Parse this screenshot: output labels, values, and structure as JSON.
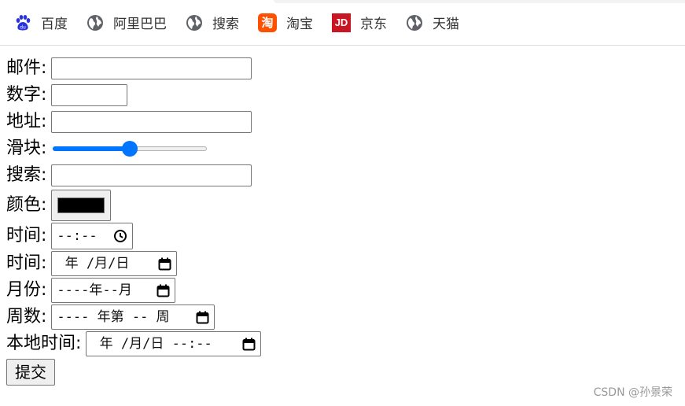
{
  "bookmarks": [
    {
      "label": "百度",
      "icon": "baidu-paw-icon"
    },
    {
      "label": "阿里巴巴",
      "icon": "globe-icon"
    },
    {
      "label": "搜索",
      "icon": "globe-icon"
    },
    {
      "label": "淘宝",
      "icon": "taobao-icon",
      "icon_text": "淘"
    },
    {
      "label": "京东",
      "icon": "jd-icon",
      "icon_text": "JD"
    },
    {
      "label": "天猫",
      "icon": "globe-icon"
    }
  ],
  "form": {
    "email_label": "邮件:",
    "number_label": "数字:",
    "url_label": "地址:",
    "range_label": "滑块:",
    "range_value": 0.5,
    "search_label": "搜索:",
    "color_label": "颜色:",
    "color_value": "#000000",
    "time_label": "时间:",
    "time_placeholder": "--:--",
    "date_label": "时间:",
    "date_placeholder": " 年 /月/日",
    "month_label": "月份:",
    "month_placeholder": "----年--月",
    "week_label": "周数:",
    "week_placeholder": "---- 年第 -- 周",
    "datetime_label": "本地时间:",
    "datetime_placeholder": " 年 /月/日 --:--",
    "submit_label": "提交"
  },
  "watermark": "CSDN @孙景荣",
  "colors": {
    "accent": "#0075ff",
    "baidu": "#2932e1",
    "taobao": "#ff5000",
    "jd": "#c91623"
  }
}
